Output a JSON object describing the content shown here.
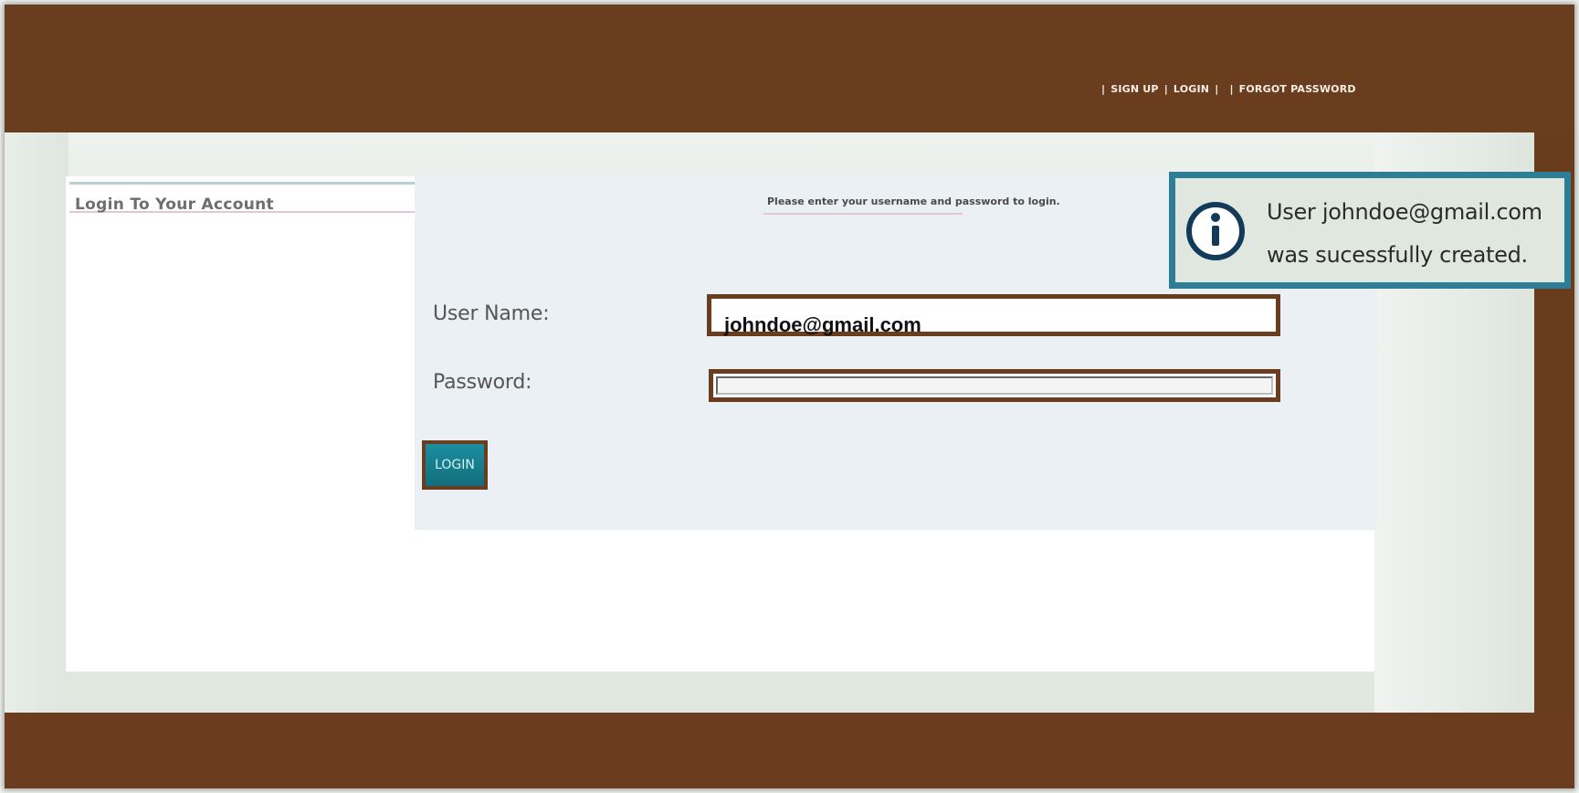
{
  "top_nav": {
    "separator": "|",
    "sign_up": "SIGN UP",
    "login": "LOGIN",
    "forgot_password": "FORGOT PASSWORD"
  },
  "page": {
    "title": "Login To Your Account",
    "hint": "Please enter your username and password to login."
  },
  "form": {
    "username_label": "User Name:",
    "username_value": "johndoe@gmail.com",
    "password_label": "Password:",
    "password_value": "",
    "login_button": "LOGIN"
  },
  "notice": {
    "icon": "info-icon",
    "line1": "User johndoe@gmail.com",
    "line2": "was sucessfully created."
  },
  "colors": {
    "frame_brown": "#6b3d1f",
    "notice_border": "#2e7d96",
    "button_teal": "#1b8ea0"
  }
}
